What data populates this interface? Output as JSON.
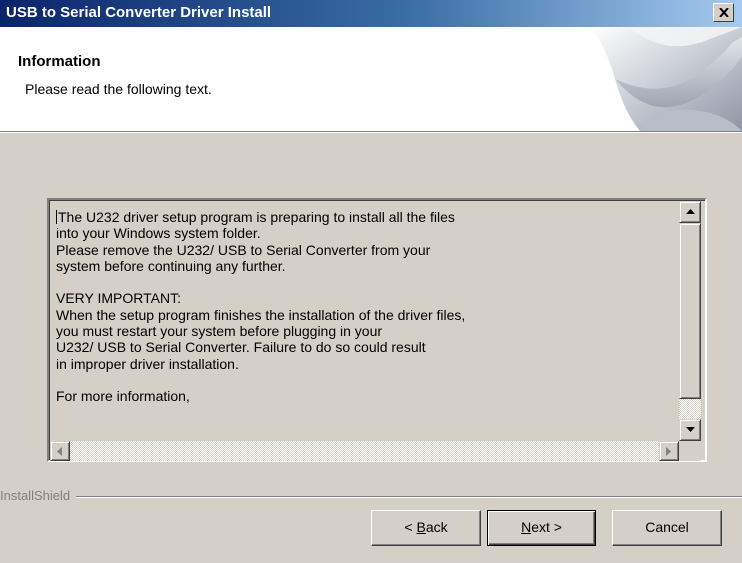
{
  "window": {
    "title": "USB to Serial Converter Driver Install"
  },
  "header": {
    "title": "Information",
    "subtitle": "Please read the following text."
  },
  "textbox": {
    "lines": [
      "The U232 driver setup program is preparing to install all the files",
      "into your Windows system folder.",
      "Please remove the U232/ USB to Serial Converter from your",
      "system before continuing any further.",
      "",
      "VERY IMPORTANT:",
      "When the setup program finishes the installation of the driver files,",
      "you must restart your system before plugging in your",
      "U232/ USB to Serial Converter. Failure to do so could result",
      "in improper driver installation.",
      "",
      "For more information,"
    ]
  },
  "branding": {
    "label": "InstallShield"
  },
  "buttons": {
    "back_prefix": "< ",
    "back_mnemonic": "B",
    "back_rest": "ack",
    "next_mnemonic": "N",
    "next_rest": "ext >",
    "cancel": "Cancel"
  },
  "icons": {
    "close": "close-icon",
    "scroll_up": "up-arrow-icon",
    "scroll_down": "down-arrow-icon",
    "scroll_left": "left-arrow-icon",
    "scroll_right": "right-arrow-icon"
  },
  "colors": {
    "titlebar_start": "#0a246a",
    "titlebar_end": "#a6caf0",
    "dialog_face": "#d4d0c8"
  }
}
